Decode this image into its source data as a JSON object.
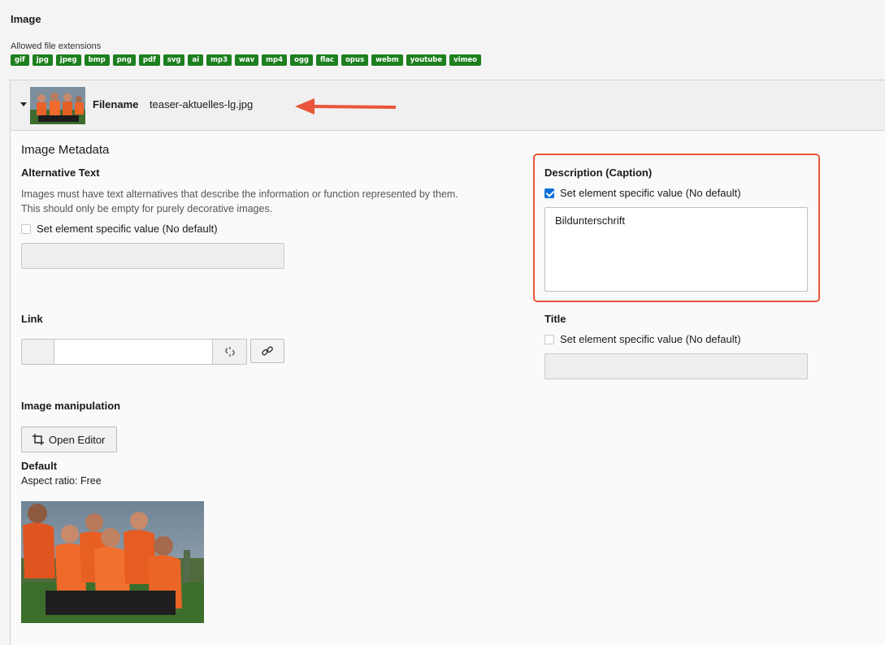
{
  "section": {
    "title": "Image"
  },
  "allowed": {
    "label": "Allowed file extensions",
    "extensions": [
      "gif",
      "jpg",
      "jpeg",
      "bmp",
      "png",
      "pdf",
      "svg",
      "ai",
      "mp3",
      "wav",
      "mp4",
      "ogg",
      "flac",
      "opus",
      "webm",
      "youtube",
      "vimeo"
    ],
    "badge_color": "#1d7f1e"
  },
  "file": {
    "filename_label": "Filename",
    "filename_value": "teaser-aktuelles-lg.jpg"
  },
  "metadata": {
    "title": "Image Metadata",
    "alt_text": {
      "label": "Alternative Text",
      "help_line1": "Images must have text alternatives that describe the information or function represented by them.",
      "help_line2": "This should only be empty for purely decorative images.",
      "checkbox_label": "Set element specific value (No default)",
      "checked": false
    },
    "description": {
      "label": "Description (Caption)",
      "checkbox_label": "Set element specific value (No default)",
      "checked": true,
      "value": "Bildunterschrift"
    },
    "link": {
      "label": "Link"
    },
    "title_field": {
      "label": "Title",
      "checkbox_label": "Set element specific value (No default)",
      "checked": false
    }
  },
  "manipulation": {
    "label": "Image manipulation",
    "open_editor_label": "Open Editor",
    "default_label": "Default",
    "aspect_ratio": "Aspect ratio: Free"
  },
  "colors": {
    "highlight": "#e8553a",
    "checkbox": "#0a6fd8"
  }
}
